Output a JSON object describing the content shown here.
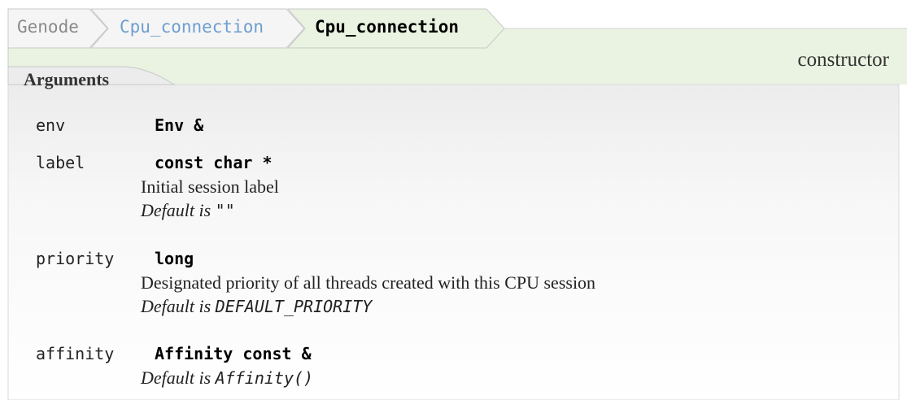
{
  "breadcrumb": {
    "items": [
      "Genode",
      "Cpu_connection",
      "Cpu_connection"
    ]
  },
  "kind": "constructor",
  "arguments": {
    "title": "Arguments",
    "items": [
      {
        "name": "env",
        "type": "Env &"
      },
      {
        "name": "label",
        "type": "const char *",
        "description": "Initial session label",
        "default_prefix": "Default is",
        "default_value": "\"\""
      },
      {
        "name": "priority",
        "type": "long",
        "description": "Designated priority of all threads created with this CPU session",
        "default_prefix": "Default is",
        "default_value": "DEFAULT_PRIORITY"
      },
      {
        "name": "affinity",
        "type": "Affinity const &",
        "default_prefix": "Default is",
        "default_value": "Affinity()"
      }
    ]
  },
  "colors": {
    "header_band": "#eaf3e1",
    "crumb_fill": "#f3f3f3",
    "current_crumb_fill": "#eaf3e1",
    "link": "#6d9ecf",
    "body_gradient_top": "#eeeeee"
  }
}
